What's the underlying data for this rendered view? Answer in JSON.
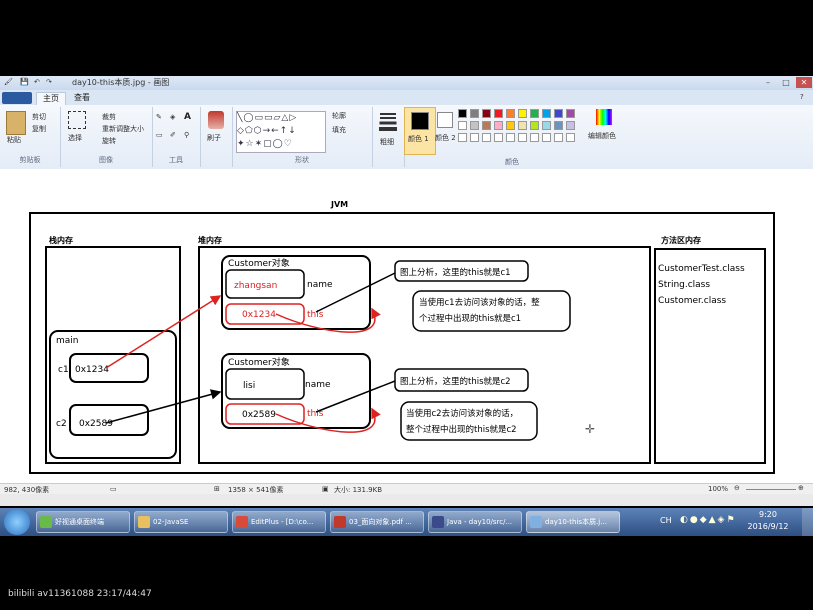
{
  "window": {
    "title": "day10-this本质.jpg - 画图"
  },
  "tabs": [
    "主页",
    "查看"
  ],
  "ribbon": {
    "paste": "粘贴",
    "cut": "剪切",
    "copy": "复制",
    "clipboard": "剪贴板",
    "select": "选择",
    "crop": "裁剪",
    "resize": "重新调整大小",
    "rotate": "旋转",
    "image": "图像",
    "tools": "工具",
    "brush": "刷子",
    "shapes": "形状",
    "outline": "轮廓",
    "fill": "填充",
    "size": "粗细",
    "color1": "颜色 1",
    "color2": "颜色 2",
    "edit_colors": "编辑颜色",
    "colors": "颜色",
    "palette_row1": [
      "#000000",
      "#7f7f7f",
      "#880015",
      "#ed1c24",
      "#ff7f27",
      "#fff200",
      "#22b14c",
      "#00a2e8",
      "#3f48cc",
      "#a349a4"
    ],
    "palette_row2": [
      "#ffffff",
      "#c3c3c3",
      "#b97a57",
      "#ffaec9",
      "#ffc90e",
      "#efe4b0",
      "#b5e61d",
      "#99d9ea",
      "#7092be",
      "#c8bfe7"
    ]
  },
  "diagram": {
    "jvm": "JVM",
    "stack": "栈内存",
    "heap": "堆内存",
    "method_area": "方法区内存",
    "main": "main",
    "c1": "c1",
    "c2": "c2",
    "c1_value": "0x1234",
    "c2_value": "0x2589",
    "obj1_title": "Customer对象",
    "obj1_name_val": "zhangsan",
    "obj1_this_val": "0x1234",
    "obj2_title": "Customer对象",
    "obj2_name_val": "lisi",
    "obj2_this_val": "0x2589",
    "name_label": "name",
    "this_label": "this",
    "note1a": "图上分析，这里的this就是c1",
    "note1b_line1": "当使用c1去访问该对象的话，整",
    "note1b_line2": "个过程中出现的this就是c1",
    "note2a": "图上分析，这里的this就是c2",
    "note2b_line1": "当使用c2去访问该对象的话，",
    "note2b_line2": "整个过程中出现的this就是c2",
    "classes": [
      "CustomerTest.class",
      "String.class",
      "Customer.class"
    ]
  },
  "status": {
    "cursor": "982, 430像素",
    "dimensions": "1358 × 541像素",
    "size": "大小: 131.9KB",
    "zoom": "100%"
  },
  "taskbar": {
    "items": [
      "好视通桌面终端",
      "02-JavaSE",
      "EditPlus - [D:\\co...",
      "03_面向对象.pdf ...",
      "Java - day10/src/...",
      "day10-this本质.j..."
    ],
    "ime": "CH",
    "time": "9:20",
    "date": "2016/9/12"
  },
  "watermark": "bilibili  av11361088 23:17/44:47"
}
